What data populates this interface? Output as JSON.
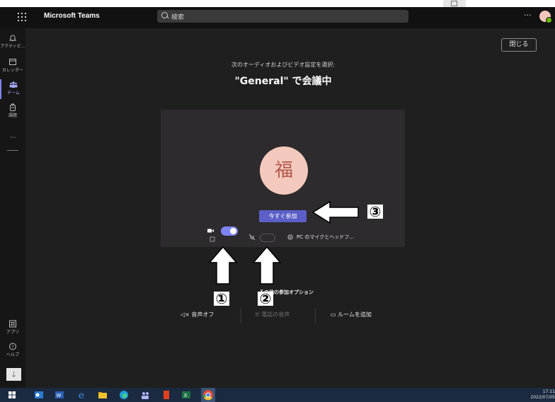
{
  "app": {
    "title": "Microsoft Teams"
  },
  "search": {
    "placeholder": "検索"
  },
  "header": {
    "more": "···"
  },
  "rail": {
    "items": [
      {
        "label": "アクティビ..."
      },
      {
        "label": "カレンダー"
      },
      {
        "label": "チーム"
      },
      {
        "label": "課題"
      }
    ],
    "more": "···",
    "apps_label": "アプリ",
    "help_label": "ヘルプ"
  },
  "prejoin": {
    "close_label": "閉じる",
    "prompt": "次のオーディオおよびビデオ設定を選択:",
    "meeting_title": "\"General\" で会議中",
    "avatar_initial": "福",
    "join_label": "今すぐ参加",
    "audio_device": "PC のマイクとヘッドフ...",
    "other_options_title": "その他の参加オプション",
    "options": {
      "audio_off": "音声オフ",
      "phone_audio": "電話の音声",
      "add_room": "ルームを追加"
    }
  },
  "annotations": {
    "one": "①",
    "two": "②",
    "three": "③"
  },
  "taskbar": {
    "time": "17:11",
    "date": "2022/07/05"
  },
  "colors": {
    "accent": "#5b5fc7",
    "toggle_on": "#7f85f5",
    "background": "#1f1f1f",
    "taskbar": "#1b2a40"
  }
}
